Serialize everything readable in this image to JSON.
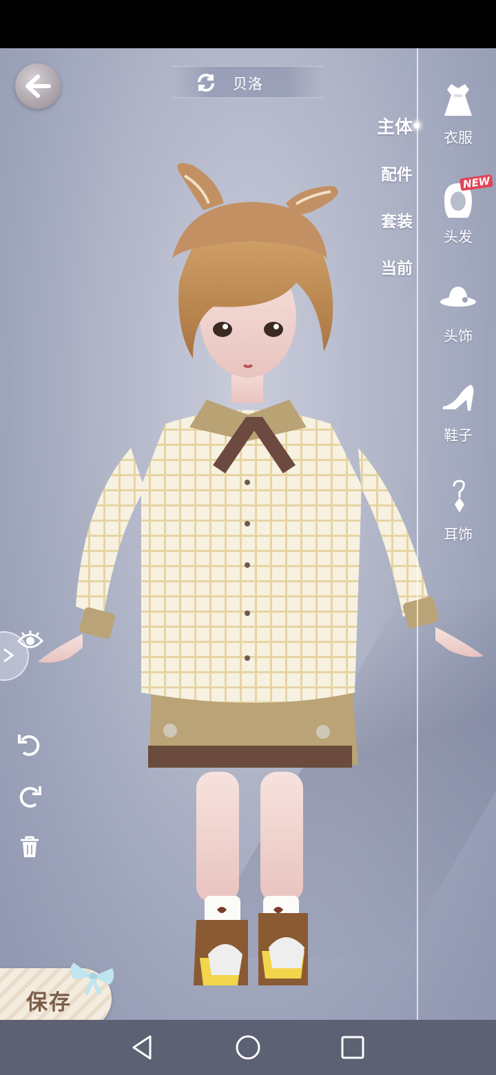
{
  "header": {
    "character_name": "贝洛",
    "back_icon": "back-arrow-icon",
    "refresh_icon": "refresh-icon"
  },
  "subtabs": [
    {
      "label": "主体",
      "active": true
    },
    {
      "label": "配件",
      "active": false
    },
    {
      "label": "套装",
      "active": false
    },
    {
      "label": "当前",
      "active": false
    }
  ],
  "categories": [
    {
      "label": "衣服",
      "icon": "dress-icon"
    },
    {
      "label": "头发",
      "icon": "hair-icon",
      "badge": "NEW"
    },
    {
      "label": "头饰",
      "icon": "hat-icon"
    },
    {
      "label": "鞋子",
      "icon": "high-heel-icon"
    },
    {
      "label": "耳饰",
      "icon": "earring-icon"
    }
  ],
  "tools": {
    "visibility_icon": "eye-icon",
    "undo_icon": "undo-icon",
    "redo_icon": "redo-icon",
    "delete_icon": "trash-icon"
  },
  "save": {
    "label": "保存"
  },
  "navbar": {
    "back": "nav-back-icon",
    "home": "nav-home-icon",
    "recents": "nav-recents-icon"
  },
  "colors": {
    "background": "#b1b6c8",
    "shirt": "#f6efdc",
    "plaid": "#e3cf9a",
    "shorts": "#b9a274",
    "hat": "#c59568",
    "hair": "#c8955a"
  }
}
